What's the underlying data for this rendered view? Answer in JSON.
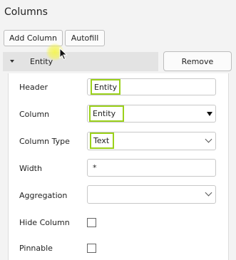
{
  "section_title": "Columns",
  "buttons": {
    "add_column": "Add Column",
    "autofill": "Autofill",
    "remove": "Remove"
  },
  "column_item": {
    "name": "Entity"
  },
  "fields": {
    "header": {
      "label": "Header",
      "value": "Entity"
    },
    "column": {
      "label": "Column",
      "value": "Entity"
    },
    "column_type": {
      "label": "Column Type",
      "value": "Text"
    },
    "width": {
      "label": "Width",
      "value": "*"
    },
    "aggregation": {
      "label": "Aggregation",
      "value": ""
    },
    "hide_column": {
      "label": "Hide Column",
      "checked": false
    },
    "pinnable": {
      "label": "Pinnable",
      "checked": false
    }
  },
  "colors": {
    "highlight": "#9bd11a",
    "cursor_highlight": "#f5f550"
  }
}
